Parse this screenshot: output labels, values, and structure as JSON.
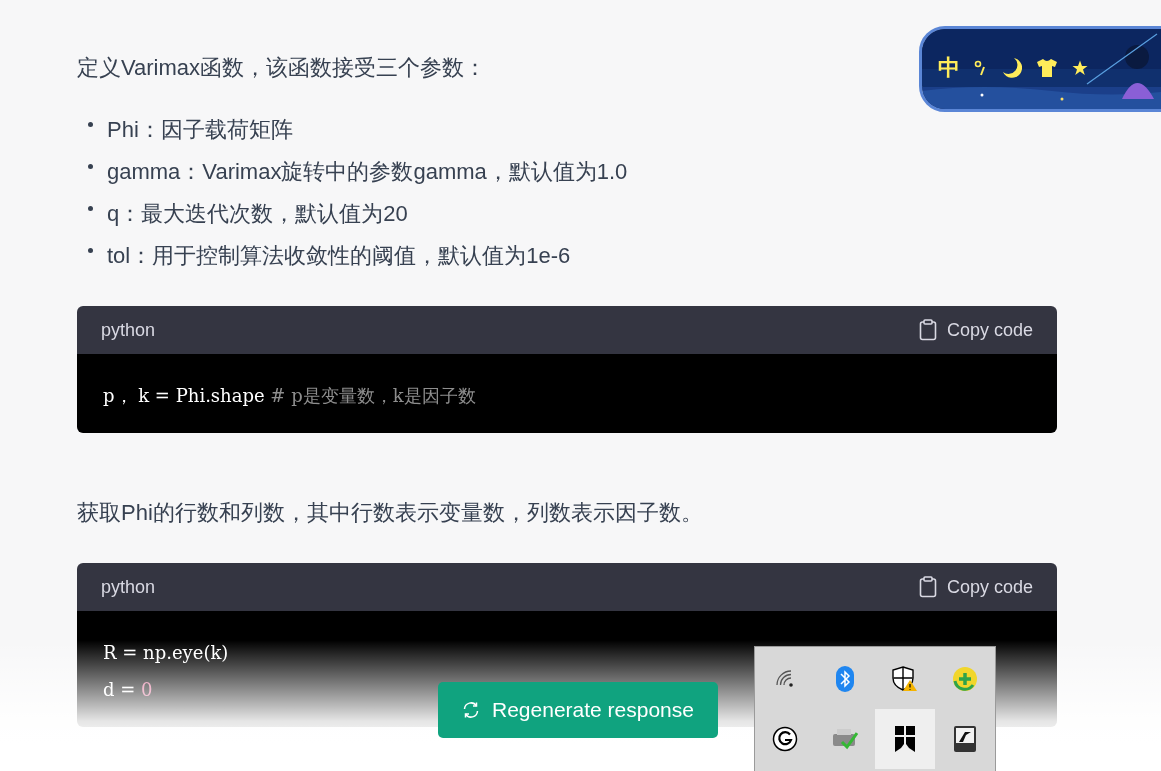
{
  "ime_bar": {
    "mode": "中"
  },
  "content": [
    {
      "kind": "paragraph",
      "text": "定义Varimax函数，该函数接受三个参数："
    },
    {
      "kind": "list",
      "items": [
        "Phi：因子载荷矩阵",
        "gamma：Varimax旋转中的参数gamma，默认值为1.0",
        "q：最大迭代次数，默认值为20",
        "tol：用于控制算法收敛性的阈值，默认值为1e-6"
      ]
    },
    {
      "kind": "code",
      "language": "python",
      "copy_label": "Copy code",
      "lines": [
        [
          {
            "kind": "plain",
            "text": "p， k = Phi.shape "
          },
          {
            "kind": "comment",
            "text": "# p是变量数，k是因子数"
          }
        ]
      ]
    },
    {
      "kind": "paragraph",
      "text": "获取Phi的行数和列数，其中行数表示变量数，列数表示因子数。"
    },
    {
      "kind": "code",
      "language": "python",
      "copy_label": "Copy code",
      "lines": [
        [
          {
            "kind": "plain",
            "text": "R = np.eye(k)"
          }
        ],
        [
          {
            "kind": "plain",
            "text": "d = "
          },
          {
            "kind": "number",
            "text": "0"
          }
        ]
      ]
    }
  ],
  "regenerate_button": {
    "label": "Regenerate response"
  },
  "tray": {
    "icons": [
      {
        "kind": "wifi",
        "selected": false
      },
      {
        "kind": "bluetooth",
        "selected": false
      },
      {
        "kind": "shield",
        "selected": false
      },
      {
        "kind": "plus",
        "selected": false
      },
      {
        "kind": "g",
        "selected": false
      },
      {
        "kind": "printer",
        "selected": false
      },
      {
        "kind": "squares",
        "selected": true
      },
      {
        "kind": "tile",
        "selected": false
      }
    ]
  }
}
